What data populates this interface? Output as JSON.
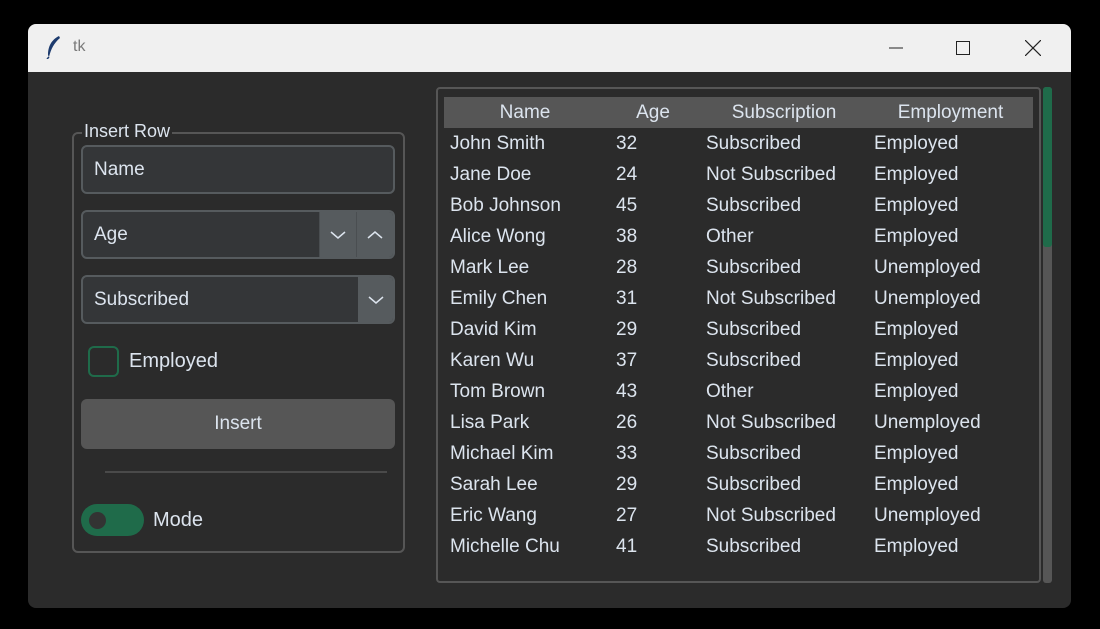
{
  "window": {
    "title": "tk",
    "controls": [
      "minimize-icon",
      "maximize-icon",
      "close-icon"
    ]
  },
  "form": {
    "group_label": "Insert Row",
    "name_placeholder": "Name",
    "age_placeholder": "Age",
    "subscription_value": "Subscribed",
    "employed_label": "Employed",
    "employed_checked": false,
    "insert_label": "Insert",
    "mode_label": "Mode",
    "mode_on": true
  },
  "table": {
    "columns": [
      "Name",
      "Age",
      "Subscription",
      "Employment"
    ],
    "rows": [
      [
        "John Smith",
        "32",
        "Subscribed",
        "Employed"
      ],
      [
        "Jane Doe",
        "24",
        "Not Subscribed",
        "Employed"
      ],
      [
        "Bob Johnson",
        "45",
        "Subscribed",
        "Employed"
      ],
      [
        "Alice Wong",
        "38",
        "Other",
        "Employed"
      ],
      [
        "Mark Lee",
        "28",
        "Subscribed",
        "Unemployed"
      ],
      [
        "Emily Chen",
        "31",
        "Not Subscribed",
        "Unemployed"
      ],
      [
        "David Kim",
        "29",
        "Subscribed",
        "Employed"
      ],
      [
        "Karen Wu",
        "37",
        "Subscribed",
        "Employed"
      ],
      [
        "Tom Brown",
        "43",
        "Other",
        "Employed"
      ],
      [
        "Lisa Park",
        "26",
        "Not Subscribed",
        "Unemployed"
      ],
      [
        "Michael Kim",
        "33",
        "Subscribed",
        "Employed"
      ],
      [
        "Sarah Lee",
        "29",
        "Subscribed",
        "Employed"
      ],
      [
        "Eric Wang",
        "27",
        "Not Subscribed",
        "Unemployed"
      ],
      [
        "Michelle Chu",
        "41",
        "Subscribed",
        "Employed"
      ]
    ]
  },
  "colors": {
    "accent": "#1f6b4a",
    "background": "#2b2b2b",
    "button": "#565656",
    "text": "#dce4ee"
  }
}
